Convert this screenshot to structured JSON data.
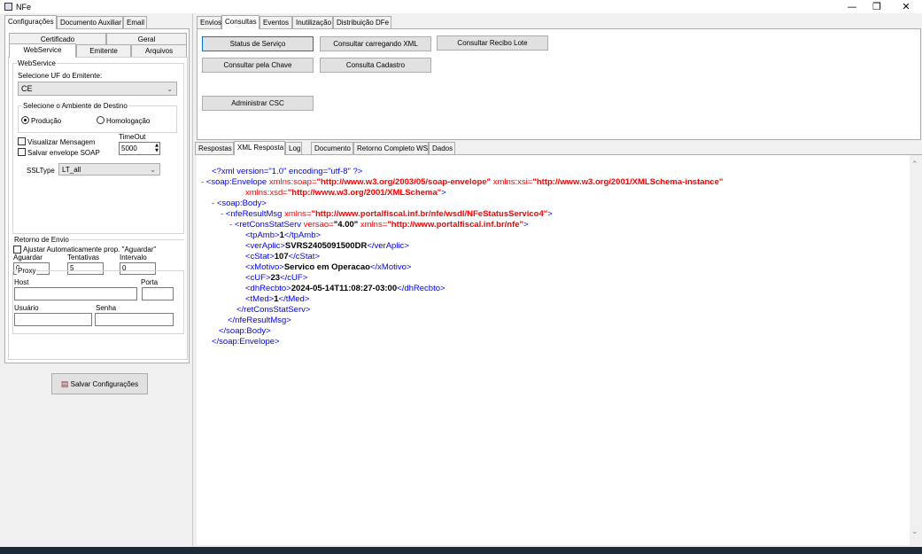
{
  "window": {
    "title": "NFe",
    "minimize": "—",
    "restore": "❐",
    "close": "✕"
  },
  "left": {
    "top_tabs": [
      "Configurações",
      "Documento Auxiliar",
      "Email"
    ],
    "sub_tabs_row1": [
      "Certificado",
      "Geral"
    ],
    "sub_tabs_row2": [
      "WebService",
      "Emitente",
      "Arquivos"
    ],
    "webservice_group": "WebService",
    "uf_label": "Selecione UF do Emitente:",
    "uf_value": "CE",
    "ambiente_group": "Selecione o Ambiente de Destino",
    "producao": "Produção",
    "homologacao": "Homologação",
    "visualizar": "Visualizar Mensagem",
    "salvar_soap": "Salvar envelope SOAP",
    "timeout_label": "TimeOut",
    "timeout_value": "5000",
    "ssltype_label": "SSLType",
    "ssltype_value": "LT_all",
    "retorno_group": "Retorno de Envio",
    "ajustar": "Ajustar Automaticamente prop. \"Aguardar\"",
    "aguardar_label": "Aguardar",
    "aguardar_value": "0",
    "tentativas_label": "Tentativas",
    "tentativas_value": "5",
    "intervalo_label": "Intervalo",
    "intervalo_value": "0",
    "proxy_group": "Proxy",
    "host_label": "Host",
    "porta_label": "Porta",
    "usuario_label": "Usuário",
    "senha_label": "Senha",
    "save_button": "Salvar Configurações"
  },
  "right": {
    "top_tabs": [
      "Envios",
      "Consultas",
      "Eventos",
      "Inutilização",
      "Distribuição DFe"
    ],
    "buttons": {
      "status": "Status de Serviço",
      "consultar_xml": "Consultar carregando XML",
      "consultar_recibo": "Consultar Recibo Lote",
      "consultar_chave": "Consultar pela Chave",
      "consulta_cadastro": "Consulta Cadastro",
      "administrar_csc": "Administrar CSC"
    },
    "bottom_tabs": [
      "Respostas",
      "XML Resposta",
      "Log",
      "Documento",
      "Retorno Completo WS",
      "Dados"
    ]
  },
  "xml": {
    "decl_start": "<?xml version=\"1.0\" encoding=\"utf-8\" ?>",
    "minus": "-",
    "env_open": "<soap:Envelope",
    "env_attr1_n": " xmlns:soap=",
    "env_attr1_v": "\"http://www.w3.org/2003/05/soap-envelope\"",
    "env_attr2_n": " xmlns:xsi=",
    "env_attr2_v": "\"http://www.w3.org/2001/XMLSchema-instance\"",
    "env_attr3_n": "xmlns:xsd=",
    "env_attr3_v": "\"http://www.w3.org/2001/XMLSchema\"",
    "gt": ">",
    "body_open": "<soap:Body>",
    "nfe_open": "<nfeResultMsg",
    "nfe_attr_n": " xmlns=",
    "nfe_attr_v": "\"http://www.portalfiscal.inf.br/nfe/wsdl/NFeStatusServico4\"",
    "ret_open": "<retConsStatServ",
    "ret_attr1_n": " versao=",
    "ret_attr1_v": "\"4.00\"",
    "ret_attr2_n": " xmlns=",
    "ret_attr2_v": "\"http://www.portalfiscal.inf.br/nfe\"",
    "fields": [
      {
        "tag": "tpAmb",
        "value": "1"
      },
      {
        "tag": "verAplic",
        "value": "SVRS2405091500DR"
      },
      {
        "tag": "cStat",
        "value": "107"
      },
      {
        "tag": "xMotivo",
        "value": "Servico em Operacao"
      },
      {
        "tag": "cUF",
        "value": "23"
      },
      {
        "tag": "dhRecbto",
        "value": "2024-05-14T11:08:27-03:00"
      },
      {
        "tag": "tMed",
        "value": "1"
      }
    ],
    "ret_close": "</retConsStatServ>",
    "nfe_close": "</nfeResultMsg>",
    "body_close": "</soap:Body>",
    "env_close": "</soap:Envelope>"
  }
}
